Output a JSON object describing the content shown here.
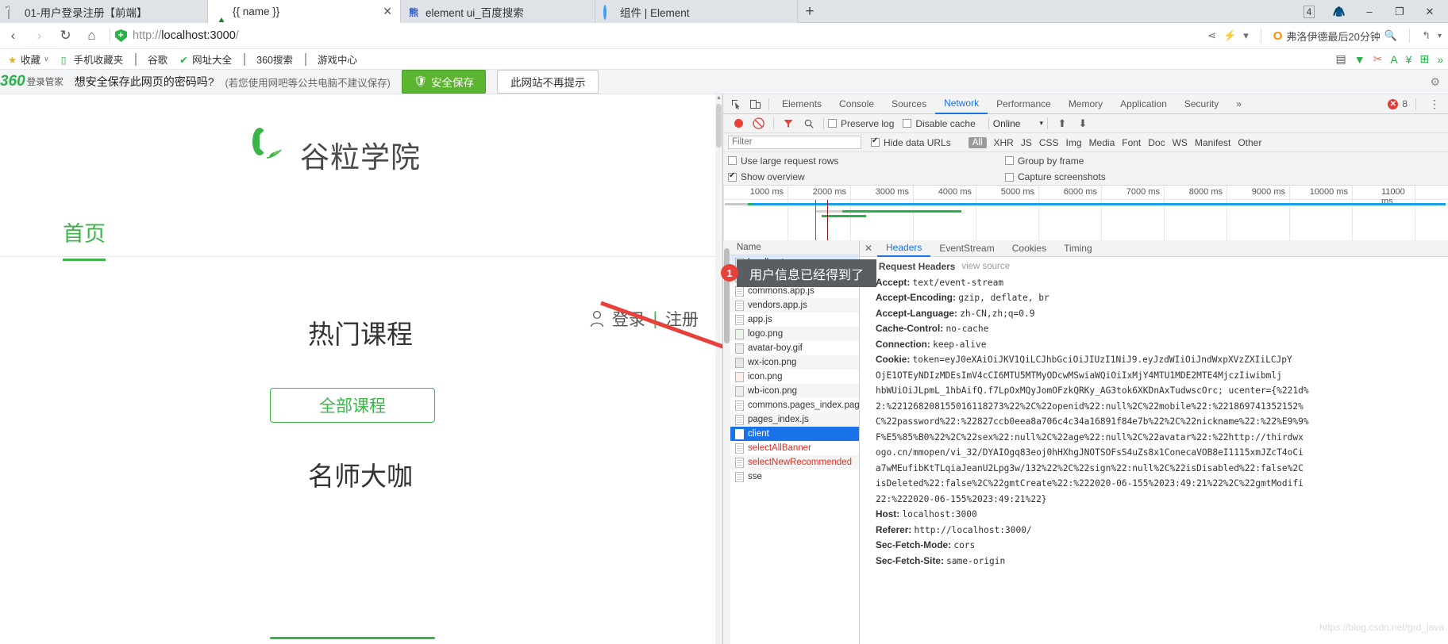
{
  "browser": {
    "tabs": [
      {
        "title": "01-用户登录注册【前端】",
        "icon": "document-icon",
        "active": false
      },
      {
        "title": "{{ name }}",
        "icon": "triangle-icon",
        "active": true
      },
      {
        "title": "element ui_百度搜索",
        "icon": "baidu-icon",
        "active": false
      },
      {
        "title": "组件 | Element",
        "icon": "element-icon",
        "active": false
      }
    ],
    "new_tab_label": "+",
    "window": {
      "tab_count": "4",
      "shirt_icon": "clothes-icon",
      "minimize": "–",
      "maximize": "❐",
      "close": "↩"
    },
    "nav": {
      "back": "‹",
      "forward": "›",
      "reload": "↻",
      "home": "⌂"
    },
    "url_protocol": "http://",
    "url_host": "localhost:3000",
    "url_path": "/",
    "right_tools": {
      "share": "share-icon",
      "lightning": "lightning-icon",
      "chevron": "▾",
      "search_value": "弗洛伊德最后20分钟",
      "o_logo": "O",
      "undo": "↰"
    },
    "bookmarks": [
      {
        "label": "收藏",
        "icon": "star-icon",
        "caret": "∨"
      },
      {
        "label": "手机收藏夹",
        "icon": "phone-icon"
      },
      {
        "label": "谷歌",
        "icon": "document-icon"
      },
      {
        "label": "网址大全",
        "icon": "hao123-icon"
      },
      {
        "label": "360搜索",
        "icon": "document-icon"
      },
      {
        "label": "游戏中心",
        "icon": "document-icon"
      }
    ]
  },
  "password_bar": {
    "brand_num": "360",
    "brand_text": "登录管家",
    "question": "想安全保存此网页的密码吗?",
    "hint": "(若您使用网吧等公共电脑不建议保存)",
    "save_button": "安全保存",
    "never_button": "此网站不再提示",
    "gear": "gear-icon"
  },
  "site": {
    "logo_text": "谷粒学院",
    "nav_home": "首页",
    "login": "登录",
    "divider": "|",
    "register": "注册",
    "hot_courses_title": "热门课程",
    "all_courses_button": "全部课程",
    "master_title": "名师大咖",
    "brand_green": "#3bb54a"
  },
  "annotation": {
    "badge": "1",
    "tooltip": "用户信息已经得到了",
    "arrow_color": "#e8413a"
  },
  "devtools": {
    "panel_tabs": [
      "Elements",
      "Console",
      "Sources",
      "Network",
      "Performance",
      "Memory",
      "Application",
      "Security"
    ],
    "active_panel": "Network",
    "overflow": "»",
    "error_count": "8",
    "kebab": "⋮",
    "inspect_icon": "inspect-icon",
    "device_icon": "device-toggle-icon",
    "toolbar": {
      "record": "record-icon",
      "clear": "clear-icon",
      "filter": "filter-icon",
      "search": "search-icon",
      "preserve_log": "Preserve log",
      "preserve_log_checked": false,
      "disable_cache": "Disable cache",
      "disable_cache_checked": false,
      "throttling": "Online",
      "throttling_caret": "▾",
      "import_icon": "import-har-icon",
      "export_icon": "export-har-icon"
    },
    "filter_row": {
      "placeholder": "Filter",
      "value": "",
      "hide_data_urls": "Hide data URLs",
      "hide_data_urls_checked": true,
      "types": [
        "All",
        "XHR",
        "JS",
        "CSS",
        "Img",
        "Media",
        "Font",
        "Doc",
        "WS",
        "Manifest",
        "Other"
      ],
      "active_type": "All"
    },
    "options": {
      "use_large_request_rows": "Use large request rows",
      "use_large_request_rows_checked": false,
      "group_by_frame": "Group by frame",
      "group_by_frame_checked": false,
      "show_overview": "Show overview",
      "show_overview_checked": true,
      "capture_screenshots": "Capture screenshots",
      "capture_screenshots_checked": false
    },
    "timeline": {
      "ticks": [
        "1000 ms",
        "2000 ms",
        "3000 ms",
        "4000 ms",
        "5000 ms",
        "6000 ms",
        "7000 ms",
        "8000 ms",
        "9000 ms",
        "10000 ms",
        "11000 ms"
      ]
    },
    "requests_column_header": "Name",
    "requests": [
      {
        "name": "localhost",
        "icon": "doc-icon",
        "selected": false,
        "highlight": true,
        "error": false
      },
      {
        "name": "runtime.js",
        "icon": "doc-icon",
        "selected": false,
        "error": false
      },
      {
        "name": "commons.app.js",
        "icon": "doc-icon",
        "selected": false,
        "error": false
      },
      {
        "name": "vendors.app.js",
        "icon": "doc-icon",
        "selected": false,
        "error": false
      },
      {
        "name": "app.js",
        "icon": "doc-icon",
        "selected": false,
        "error": false
      },
      {
        "name": "logo.png",
        "icon": "image-icon",
        "selected": false,
        "error": false
      },
      {
        "name": "avatar-boy.gif",
        "icon": "image-icon",
        "selected": false,
        "error": false
      },
      {
        "name": "wx-icon.png",
        "icon": "image-icon",
        "selected": false,
        "error": false
      },
      {
        "name": "icon.png",
        "icon": "image-icon",
        "selected": false,
        "error": false
      },
      {
        "name": "wb-icon.png",
        "icon": "image-icon",
        "selected": false,
        "error": false
      },
      {
        "name": "commons.pages_index.pages_l...",
        "icon": "doc-icon",
        "selected": false,
        "error": false
      },
      {
        "name": "pages_index.js",
        "icon": "doc-icon",
        "selected": false,
        "error": false
      },
      {
        "name": "client",
        "icon": "doc-icon",
        "selected": true,
        "error": false
      },
      {
        "name": "selectAllBanner",
        "icon": "doc-icon",
        "selected": false,
        "error": true
      },
      {
        "name": "selectNewRecommended",
        "icon": "doc-icon",
        "selected": false,
        "error": true
      },
      {
        "name": "sse",
        "icon": "doc-icon",
        "selected": false,
        "error": false
      }
    ],
    "detail_tabs": [
      "Headers",
      "EventStream",
      "Cookies",
      "Timing"
    ],
    "detail_active_tab": "Headers",
    "detail_close": "✕",
    "headers_section_title": "Request Headers",
    "view_source": "view source",
    "headers": [
      {
        "key": "Accept:",
        "value": "text/event-stream"
      },
      {
        "key": "Accept-Encoding:",
        "value": "gzip, deflate, br"
      },
      {
        "key": "Accept-Language:",
        "value": "zh-CN,zh;q=0.9"
      },
      {
        "key": "Cache-Control:",
        "value": "no-cache"
      },
      {
        "key": "Connection:",
        "value": "keep-alive"
      },
      {
        "key": "Cookie:",
        "value": "token=eyJ0eXAiOiJKV1QiLCJhbGciOiJIUzI1NiJ9.eyJzdWIiOiJndWxpXVzZXIiLCJpY"
      }
    ],
    "cookie_continuation": [
      "OjE1OTEyNDIzMDEsImV4cCI6MTU5MTMyODcwMSwiaWQiOiIxMjY4MTU1MDE2MTE4MjczIiwibmlj",
      "hbWUiOiJLpmL_1hbAifQ.f7LpOxMQyJomOFzkQRKy_AG3tok6XKDnAxTudwscOrc; ucenter={%221d%",
      "2:%221268208155016118273%22%2C%22openid%22:null%2C%22mobile%22:%221869741352152%",
      "C%22password%22:%22827ccb0eea8a706c4c34a16891f84e7b%22%2C%22nickname%22:%22%E9%9%",
      "F%E5%85%B0%22%2C%22sex%22:null%2C%22age%22:null%2C%22avatar%22:%22http://thirdwx",
      "ogo.cn/mmopen/vi_32/DYAIOgq83eoj0hHXhgJNOTSOFsS4uZs8x1ConecaVOB8eI1115xmJZcT4oCi",
      "a7wMEufibKtTLqiaJeanU2Lpg3w/132%22%2C%22sign%22:null%2C%22isDisabled%22:false%2C",
      "isDeleted%22:false%2C%22gmtCreate%22:%222020-06-155%2023:49:21%22%2C%22gmtModifi",
      "22:%222020-06-155%2023:49:21%22}"
    ],
    "trailing_headers": [
      {
        "key": "Host:",
        "value": "localhost:3000"
      },
      {
        "key": "Referer:",
        "value": "http://localhost:3000/"
      },
      {
        "key": "Sec-Fetch-Mode:",
        "value": "cors"
      },
      {
        "key": "Sec-Fetch-Site:",
        "value": "same-origin"
      }
    ],
    "watermark": "https://blog.csdn.net/grd_java"
  }
}
